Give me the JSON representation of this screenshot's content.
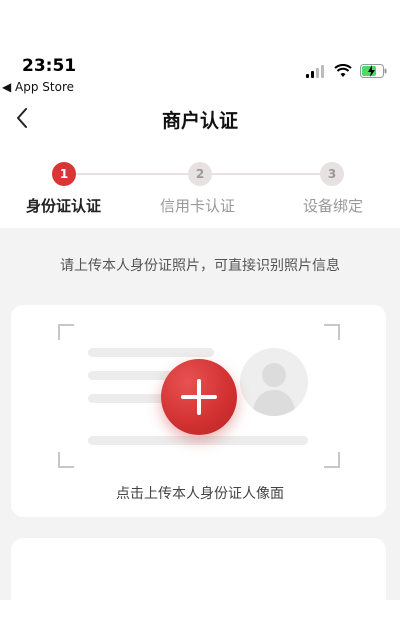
{
  "status_bar": {
    "time": "23:51",
    "back_to_app": "◀ App Store",
    "battery_color": "#4cd964"
  },
  "nav": {
    "title": "商户认证"
  },
  "steps": [
    {
      "number": "1",
      "label": "身份证认证",
      "active": true
    },
    {
      "number": "2",
      "label": "信用卡认证",
      "active": false
    },
    {
      "number": "3",
      "label": "设备绑定",
      "active": false
    }
  ],
  "hint": "请上传本人身份证照片，可直接识别照片信息",
  "id_card_upload": {
    "caption": "点击上传本人身份证人像面"
  },
  "colors": {
    "accent": "#d93535",
    "inactive_step": "#e8e1e2",
    "background": "#f3f3f3"
  }
}
